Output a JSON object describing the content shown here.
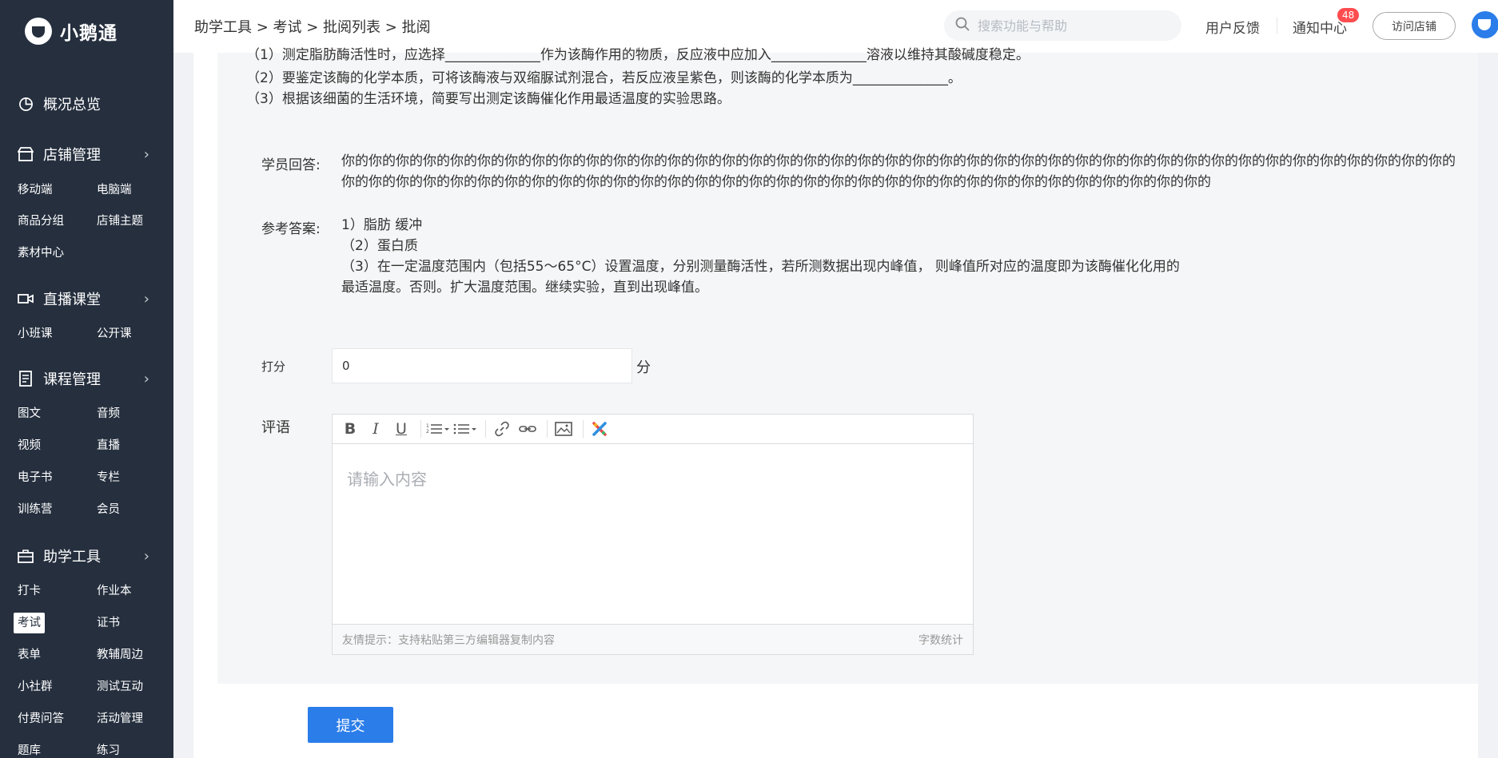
{
  "app": {
    "name": "小鹅通"
  },
  "sidebar": {
    "overview": "概况总览",
    "store": {
      "label": "店铺管理",
      "items": [
        "移动端",
        "电脑端",
        "商品分组",
        "店铺主题",
        "素材中心"
      ]
    },
    "live": {
      "label": "直播课堂",
      "items": [
        "小班课",
        "公开课"
      ]
    },
    "course": {
      "label": "课程管理",
      "items": [
        "图文",
        "音频",
        "视频",
        "直播",
        "电子书",
        "专栏",
        "训练营",
        "会员"
      ]
    },
    "tools": {
      "label": "助学工具",
      "items": [
        "打卡",
        "作业本",
        "考试",
        "证书",
        "表单",
        "教辅周边",
        "小社群",
        "测试互动",
        "付费问答",
        "活动管理",
        "题库",
        "练习"
      ]
    }
  },
  "header": {
    "breadcrumb": "助学工具 > 考试 > 批阅列表 > 批阅",
    "search_placeholder": "搜索功能与帮助",
    "feedback": "用户反馈",
    "notice": "通知中心",
    "notice_count": "48",
    "visit_store": "访问店铺"
  },
  "question": {
    "line1": "（1）测定脂肪酶活性时，应选择______________作为该酶作用的物质，反应液中应加入______________溶液以维持其酸碱度稳定。",
    "line2": "（2）要鉴定该酶的化学本质，可将该酶液与双缩脲试剂混合，若反应液呈紫色，则该酶的化学本质为______________。",
    "line3": "（3）根据该细菌的生活环境，简要写出测定该酶催化作用最适温度的实验思路。"
  },
  "answer": {
    "student_label": "学员回答:",
    "student_text": "你的你的你的你的你的你的你的你的你的你的你的你的你的你的你的你的你的你的你的你的你的你的你的你的你的你的你的你的你的你的你的你的你的你的你的你的你的你的你的你的你的你的你的你的你的你的你的你的你的你的你的你的你的你的你的你的你的你的你的你的你的你的你的你的你的你的你的你的你的你的你的你的你的",
    "reference_label": "参考答案:",
    "ref_line1": "1）脂肪  缓冲",
    "ref_line2": "（2）蛋白质",
    "ref_line3": "（3）在一定温度范围内（包括55～65°C）设置温度，分别测量酶活性，若所测数据出现内峰值，  则峰值所对应的温度即为该酶催化化用的",
    "ref_line4": "最适温度。否则。扩大温度范围。继续实验，直到出现峰值。"
  },
  "grading": {
    "score_label": "打分",
    "score_value": "0",
    "score_unit": "分",
    "comment_label": "评语",
    "editor_placeholder": "请输入内容",
    "editor_tip": "友情提示：支持粘贴第三方编辑器复制内容",
    "word_count": "字数统计",
    "submit": "提交"
  }
}
